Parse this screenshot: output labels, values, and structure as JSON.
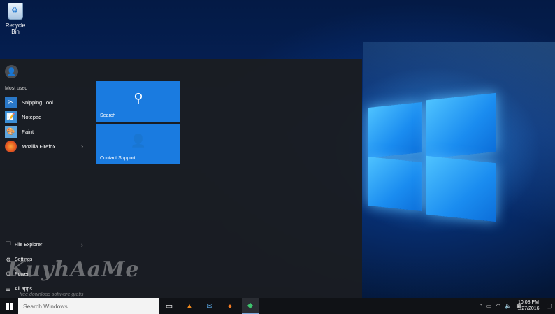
{
  "desktop": {
    "recycle_bin_label": "Recycle Bin"
  },
  "start_menu": {
    "most_used_heading": "Most used",
    "apps": [
      {
        "label": "Snipping Tool",
        "icon": "scissors-icon"
      },
      {
        "label": "Notepad",
        "icon": "notepad-icon"
      },
      {
        "label": "Paint",
        "icon": "paint-palette-icon"
      },
      {
        "label": "Mozilla Firefox",
        "icon": "firefox-icon",
        "has_submenu": true
      }
    ],
    "system_items": [
      {
        "label": "File Explorer",
        "icon": "folder-icon",
        "has_submenu": true
      },
      {
        "label": "Settings",
        "icon": "gear-icon"
      },
      {
        "label": "Power",
        "icon": "power-icon"
      },
      {
        "label": "All apps",
        "icon": "list-icon"
      }
    ],
    "tiles": [
      {
        "label": "Search",
        "icon": "magnifier-icon"
      },
      {
        "label": "Contact Support",
        "icon": "support-agent-icon"
      }
    ],
    "accent_color": "#1a7be0"
  },
  "watermark": {
    "text": "KuyhAaMe",
    "subtext": "free download software gratis"
  },
  "taskbar": {
    "search_placeholder": "Search Windows",
    "pinned": [
      "task-view-icon",
      "vlc-icon",
      "mail-icon",
      "firefox-icon",
      "green-app-icon"
    ],
    "clock_time": "10:08 PM",
    "clock_date": "1/27/2016"
  }
}
